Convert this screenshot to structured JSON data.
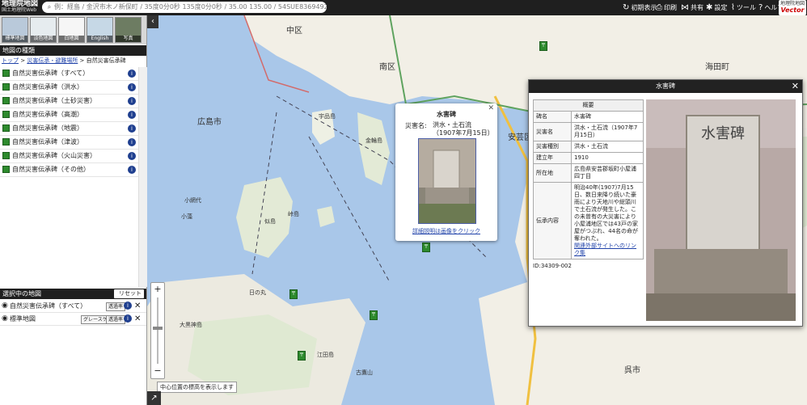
{
  "header": {
    "logo_line1": "地理院地図",
    "logo_line2": "国土地理院Web",
    "search_placeholder": "例：経島 / 金沢市木ノ新保町 / 35度0分0秒 135度0分0秒 / 35.00 135.00 / 54SUE83694920",
    "buttons": [
      {
        "label": "初期表示",
        "icon": "↻"
      },
      {
        "label": "印刷",
        "icon": "⎙"
      },
      {
        "label": "共有",
        "icon": "⋈"
      },
      {
        "label": "設定",
        "icon": "✱"
      },
      {
        "label": "ツール",
        "icon": "⌇"
      },
      {
        "label": "ヘルプ",
        "icon": "?"
      }
    ],
    "vector_badge_top": "地理院地図",
    "vector_badge_bottom": "Vector"
  },
  "thumbs": [
    "標準地図",
    "淡色地図",
    "白地図",
    "English",
    "写真"
  ],
  "map_kinds": {
    "title": "地図の種類",
    "breadcrumb_top": "トップ",
    "breadcrumb_mid": "災害伝承・避難場所",
    "breadcrumb_current": "自然災害伝承碑",
    "items": [
      "自然災害伝承碑（すべて）",
      "自然災害伝承碑（洪水）",
      "自然災害伝承碑（土砂災害）",
      "自然災害伝承碑（高潮）",
      "自然災害伝承碑（地震）",
      "自然災害伝承碑（津波）",
      "自然災害伝承碑（火山災害）",
      "自然災害伝承碑（その他）"
    ]
  },
  "selected": {
    "title": "選択中の地図",
    "reset_label": "リセット",
    "items": [
      {
        "label": "自然災害伝承碑（すべて）",
        "tag1": "透過率",
        "tag2": ""
      },
      {
        "label": "標準地図",
        "tag1": "グレースケール",
        "tag2": "透過率"
      }
    ]
  },
  "map": {
    "center_label": "中心位置の標高を表示します",
    "labels": {
      "naka": "中区",
      "minami": "南区",
      "hiroshima": "広島市",
      "kaita": "海田町",
      "aki": "安芸区",
      "kure": "呉市",
      "ukurujima": "宇品島",
      "kanawa": "金輪島",
      "ninoshima": "似島",
      "eta": "江田島",
      "kotaka": "古鷹山",
      "koami": "小網代",
      "obako": "峠島",
      "ogai": "小藻",
      "nishiki": "日の丸",
      "okura": "大黒神島"
    }
  },
  "popup_small": {
    "title": "水害碑",
    "key": "災害名:",
    "value_line1": "洪水・土石流",
    "value_line2": "（1907年7月15日）",
    "link": "詳細説明は画像をクリック"
  },
  "popup_big": {
    "title": "水害碑",
    "table_header": "概要",
    "rows": [
      {
        "k": "碑名",
        "v": "水害碑"
      },
      {
        "k": "災害名",
        "v": "洪水・土石流（1907年7月15日）"
      },
      {
        "k": "災害種別",
        "v": "洪水・土石流"
      },
      {
        "k": "建立年",
        "v": "1910"
      },
      {
        "k": "所在地",
        "v": "広島県安芸郡坂町小屋浦四丁目"
      },
      {
        "k": "伝承内容",
        "v": "明治40年(1907)7月15日、数日来降り続いた豪雨により天地川や総頭川で土石流が発生した。この未曽有の大災害により小屋浦地区では43戸の家屋がつぶれ、44名の命が奪われた。"
      }
    ],
    "link": "関連外部サイトへのリンク集",
    "id_text": "ID:34309-002",
    "monument_text": "水害碑"
  }
}
